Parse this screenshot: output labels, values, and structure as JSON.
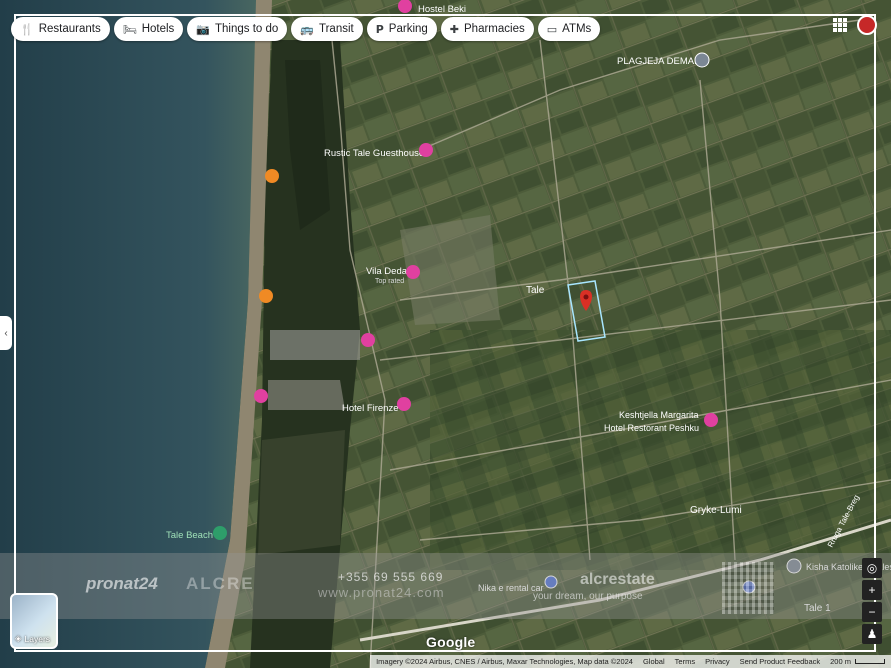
{
  "chips": [
    {
      "label": "Restaurants",
      "icon": "fork-knife-icon",
      "glyph": "🍴"
    },
    {
      "label": "Hotels",
      "icon": "bed-icon",
      "glyph": "🛏"
    },
    {
      "label": "Things to do",
      "icon": "camera-icon",
      "glyph": "📷"
    },
    {
      "label": "Transit",
      "icon": "bus-icon",
      "glyph": "🚌"
    },
    {
      "label": "Parking",
      "icon": "parking-icon",
      "glyph": "P"
    },
    {
      "label": "Pharmacies",
      "icon": "pharmacy-icon",
      "glyph": "✚"
    },
    {
      "label": "ATMs",
      "icon": "atm-icon",
      "glyph": "▭"
    }
  ],
  "places": {
    "hostel_beki": "Hostel Beki",
    "plazhi": "PLAGJEJA DEMAKU",
    "rustic": "Rustic Tale Guesthouse",
    "vila_deda": "Vila Deda",
    "vila_deda_sub": "Top rated",
    "tale": "Tale",
    "hotel_firenze": "Hotel Firenze",
    "kesh_1": "Keshtjella Margarita",
    "kesh_2": "Hotel Restorant Peshku",
    "gryke": "Gryke-Lumi",
    "tale_beach": "Tale Beach",
    "nika": "Nika e rental car",
    "kisha": "Kisha Katolike e Tales",
    "tale1": "Tale 1",
    "rruga": "Rruga Tale-Breg"
  },
  "layers_label": "Layers",
  "google_label": "Google",
  "attribution": {
    "text": "Imagery ©2024 Airbus, CNES / Airbus, Maxar Technologies, Map data ©2024",
    "links": [
      "Global",
      "Terms",
      "Privacy",
      "Send Product Feedback"
    ],
    "scale": "200 m"
  },
  "watermark": {
    "brand": "pronat24",
    "brand2": "ALCRE",
    "phone": "+355 69 555 669",
    "web": "www.pronat24.com",
    "brand3": "alcrestate",
    "tagline": "your dream, our purpose"
  },
  "colors": {
    "sea": "#2c4a56",
    "farmland": "#4a5a3a",
    "pin_red": "#d93025",
    "hotel_pink": "#e040a0",
    "restaurant_orange": "#f08a24",
    "poi_green": "#2e9e6a",
    "parcel_outline": "#a8e6ff"
  }
}
